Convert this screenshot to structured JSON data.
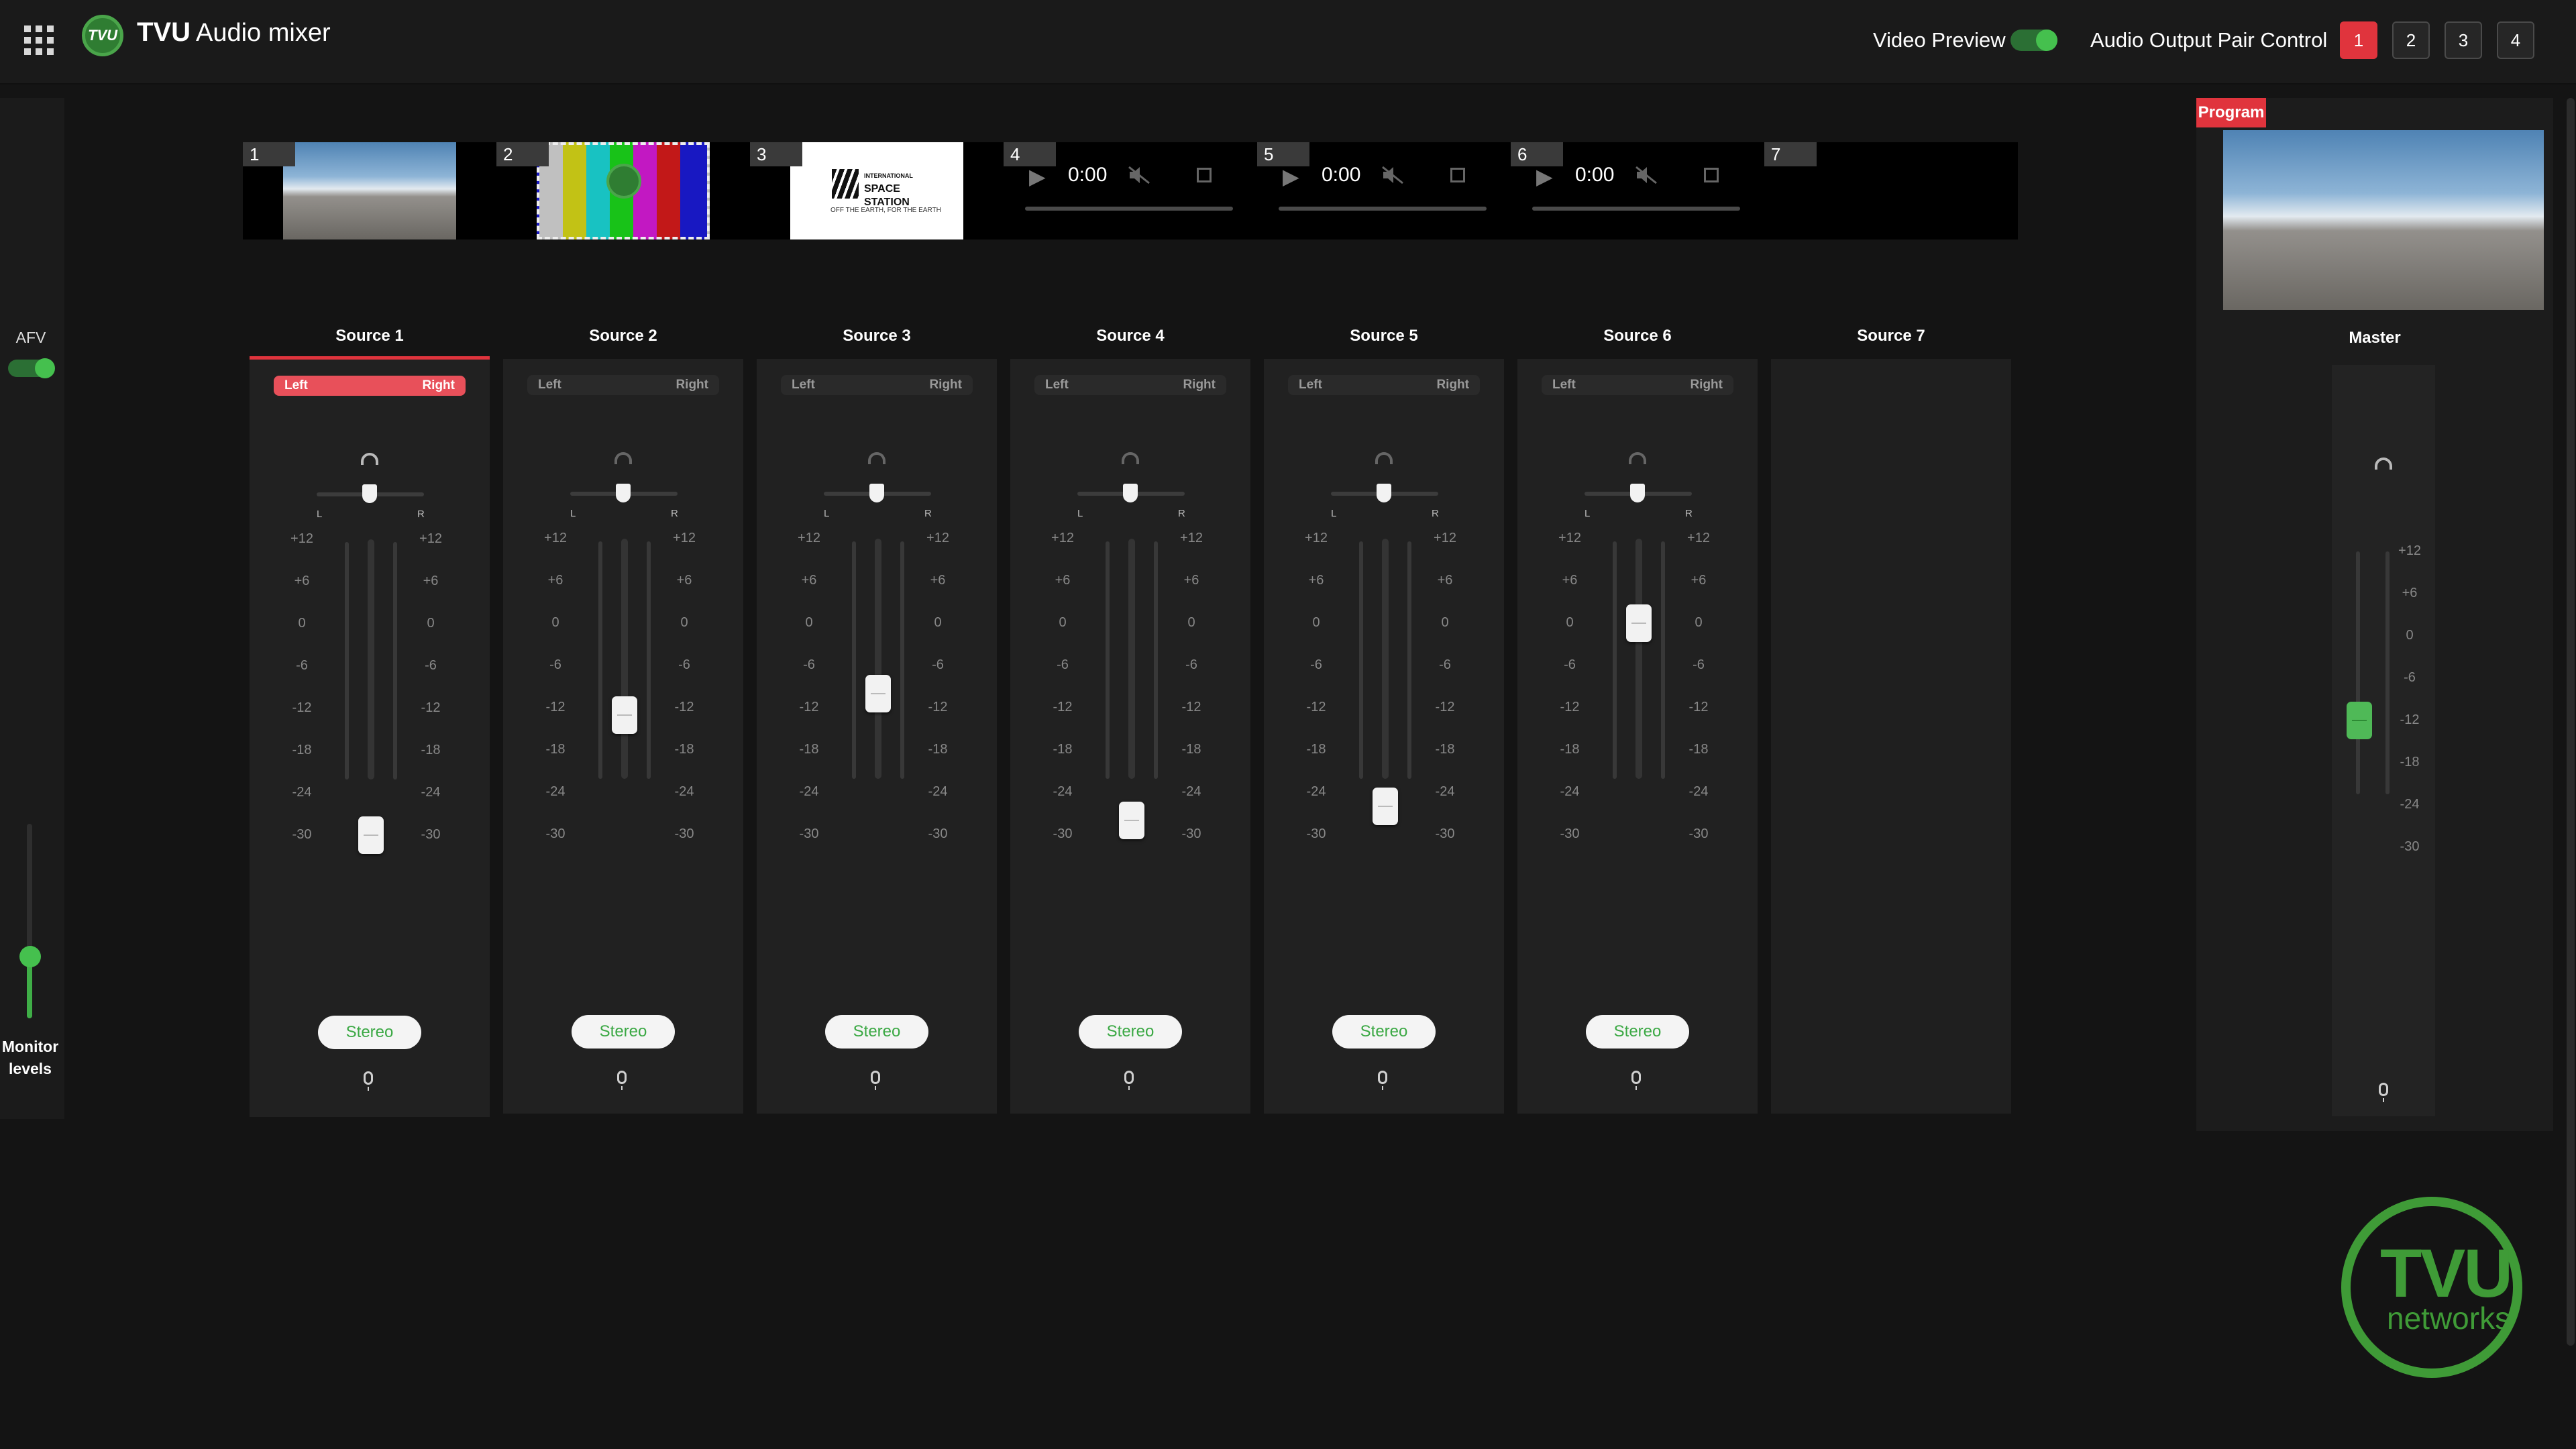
{
  "header": {
    "brand": "TVU",
    "app_title": "Audio mixer",
    "video_preview_label": "Video Preview",
    "video_preview_on": true,
    "audio_output_label": "Audio Output Pair Control",
    "pair_buttons": [
      "1",
      "2",
      "3",
      "4"
    ],
    "active_pair": "1"
  },
  "left_rail": {
    "afv_label": "AFV",
    "afv_on": true,
    "monitor_levels_label": "Monitor levels",
    "monitor_level": 0.3
  },
  "preview_tiles": [
    {
      "number": "1",
      "type": "image",
      "thumb": "birds-beach"
    },
    {
      "number": "2",
      "type": "image",
      "thumb": "test-pattern"
    },
    {
      "number": "3",
      "type": "image",
      "thumb": "iss-logo",
      "text_lines": [
        "INTERNATIONAL",
        "SPACE",
        "STATION"
      ],
      "subtext": "OFF THE EARTH, FOR THE EARTH"
    },
    {
      "number": "4",
      "type": "video",
      "time": "0:00"
    },
    {
      "number": "5",
      "type": "video",
      "time": "0:00"
    },
    {
      "number": "6",
      "type": "video",
      "time": "0:00"
    },
    {
      "number": "7",
      "type": "empty"
    }
  ],
  "scale_labels": [
    "+12",
    "+6",
    "0",
    "-6",
    "-12",
    "-18",
    "-24",
    "-30"
  ],
  "channels": [
    {
      "label": "Source 1",
      "left": "Left",
      "right": "Right",
      "lr_active": true,
      "selected": true,
      "fader_db": -30,
      "stereo": "Stereo"
    },
    {
      "label": "Source 2",
      "left": "Left",
      "right": "Right",
      "lr_active": false,
      "selected": false,
      "fader_db": -13,
      "stereo": "Stereo"
    },
    {
      "label": "Source 3",
      "left": "Left",
      "right": "Right",
      "lr_active": false,
      "selected": false,
      "fader_db": -10,
      "stereo": "Stereo"
    },
    {
      "label": "Source 4",
      "left": "Left",
      "right": "Right",
      "lr_active": false,
      "selected": false,
      "fader_db": -28,
      "stereo": "Stereo"
    },
    {
      "label": "Source 5",
      "left": "Left",
      "right": "Right",
      "lr_active": false,
      "selected": false,
      "fader_db": -26,
      "stereo": "Stereo"
    },
    {
      "label": "Source 6",
      "left": "Left",
      "right": "Right",
      "lr_active": false,
      "selected": false,
      "fader_db": 0,
      "stereo": "Stereo"
    }
  ],
  "source7_label": "Source 7",
  "pan": {
    "l": "L",
    "r": "R"
  },
  "program": {
    "badge": "Program",
    "master_label": "Master",
    "master_fader_db": -12
  },
  "colors": {
    "accent_red": "#e0343d",
    "accent_green": "#45c04e",
    "logo_green": "#3f9b37"
  },
  "brand_logo": {
    "tvu": "TVU",
    "networks": "networks"
  }
}
